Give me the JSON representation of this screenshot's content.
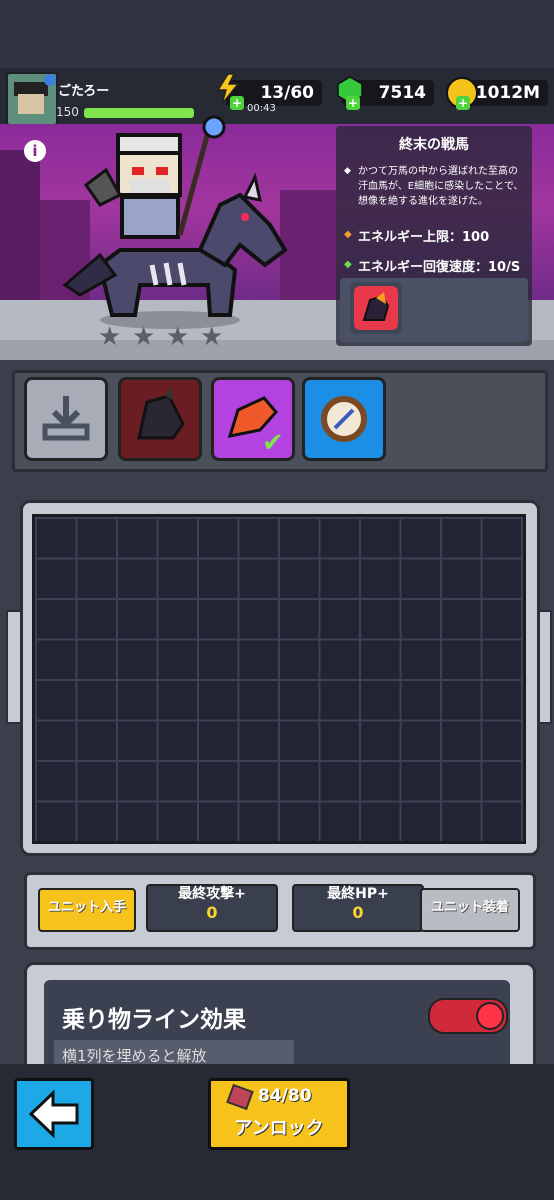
{
  "player": {
    "name": "ごたろー",
    "level": "150",
    "xp_fraction": 1.0
  },
  "resources": {
    "energy": "13/60",
    "energy_timer": "00:43",
    "gems": "7514",
    "gold": "1012M"
  },
  "mount": {
    "title": "終末の戦馬",
    "description": "かつて万馬の中から選ばれた至高の汗血馬が、E細胞に感染したことで、想像を絶する進化を遂げた。",
    "energy_cap": "エネルギー上限：100",
    "energy_regen": "エネルギー回復速度：10/S",
    "stars": [
      "★",
      "★",
      "★",
      "★"
    ]
  },
  "buttons": {
    "get_unit": "ユニット入手",
    "equip_unit": "ユニット装着"
  },
  "stats": {
    "final_attack_label": "最終攻撃+",
    "final_attack_value": "0",
    "final_hp_label": "最終HP+",
    "final_hp_value": "0"
  },
  "ride_line": {
    "title": "乗り物ライン効果",
    "subtitle": "横1列を埋めると解放"
  },
  "unlock": {
    "count": "84/80",
    "label": "アンロック"
  },
  "icons": {
    "info": "i",
    "back": "arrow-left-icon"
  },
  "colors": {
    "scene": "#a2369e",
    "xp": "#7ee64a",
    "gold_button": "#f6c21c",
    "back_button": "#1da9e8",
    "toggle": "#d02a3a"
  }
}
